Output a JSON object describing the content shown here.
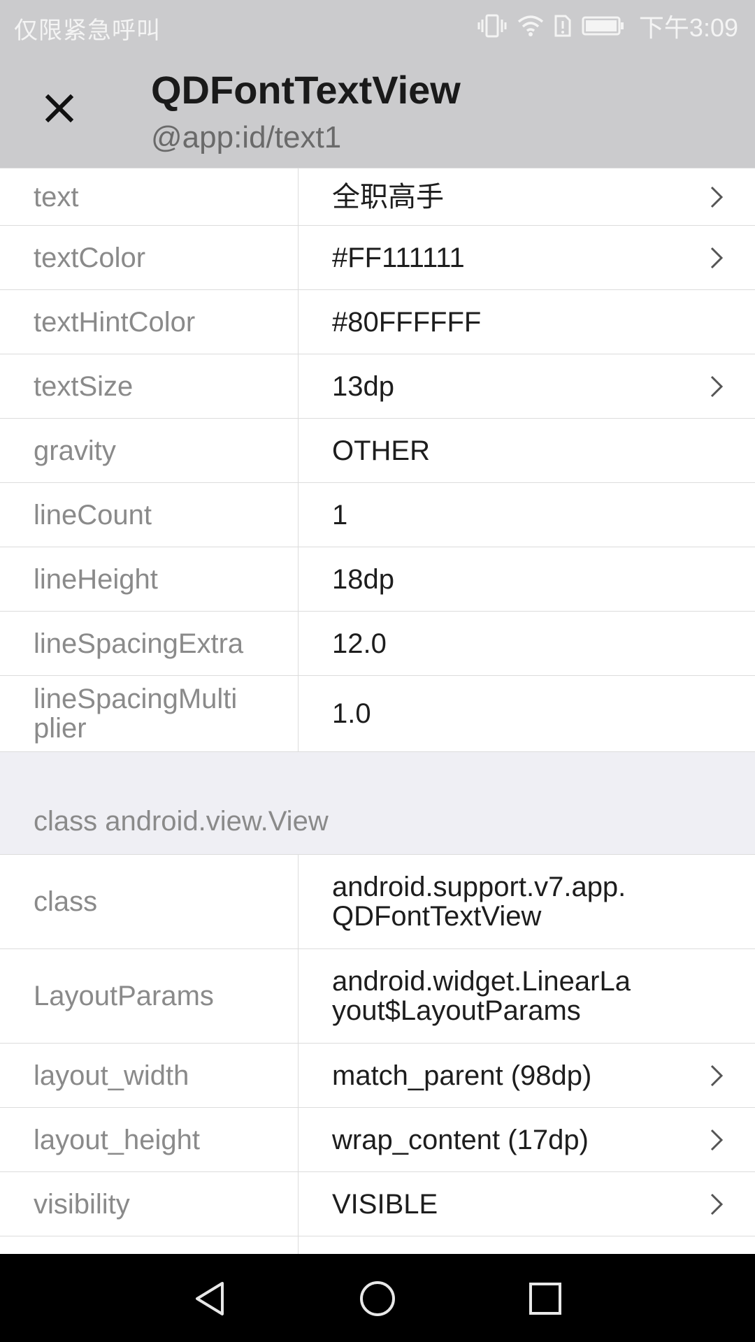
{
  "status_bar": {
    "carrier": "仅限紧急呼叫",
    "time": "下午3:09",
    "icons": [
      "vibrate-icon",
      "wifi-icon",
      "sim-alert-icon",
      "battery-icon"
    ]
  },
  "header": {
    "title": "QDFontTextView",
    "subtitle": "@app:id/text1",
    "close_icon": "close-icon"
  },
  "text_section": {
    "rows": [
      {
        "key": "text",
        "value": "全职高手",
        "chevron": true
      },
      {
        "key": "textColor",
        "value": "#FF111111",
        "chevron": true
      },
      {
        "key": "textHintColor",
        "value": "#80FFFFFF",
        "chevron": false
      },
      {
        "key": "textSize",
        "value": "13dp",
        "chevron": true
      },
      {
        "key": "gravity",
        "value": "OTHER",
        "chevron": false
      },
      {
        "key": "lineCount",
        "value": "1",
        "chevron": false
      },
      {
        "key": "lineHeight",
        "value": "18dp",
        "chevron": false
      },
      {
        "key": "lineSpacingExtra",
        "value": "12.0",
        "chevron": false
      },
      {
        "key": "lineSpacingMultiplier",
        "key_line1": "lineSpacingMulti",
        "key_line2": "plier",
        "value": "1.0",
        "chevron": false
      }
    ]
  },
  "view_section": {
    "title": "class android.view.View",
    "rows": [
      {
        "key": "class",
        "value_line1": "android.support.v7.app.",
        "value_line2": "QDFontTextView",
        "chevron": false
      },
      {
        "key": "LayoutParams",
        "value_line1": "android.widget.LinearLa",
        "value_line2": "yout$LayoutParams",
        "chevron": false
      },
      {
        "key": "layout_width",
        "value": "match_parent (98dp)",
        "chevron": true
      },
      {
        "key": "layout_height",
        "value": "wrap_content (17dp)",
        "chevron": true
      },
      {
        "key": "visibility",
        "value": "VISIBLE",
        "chevron": true
      }
    ]
  },
  "nav_bar": {
    "back_icon": "back-triangle-icon",
    "home_icon": "home-circle-icon",
    "recents_icon": "recents-square-icon"
  }
}
